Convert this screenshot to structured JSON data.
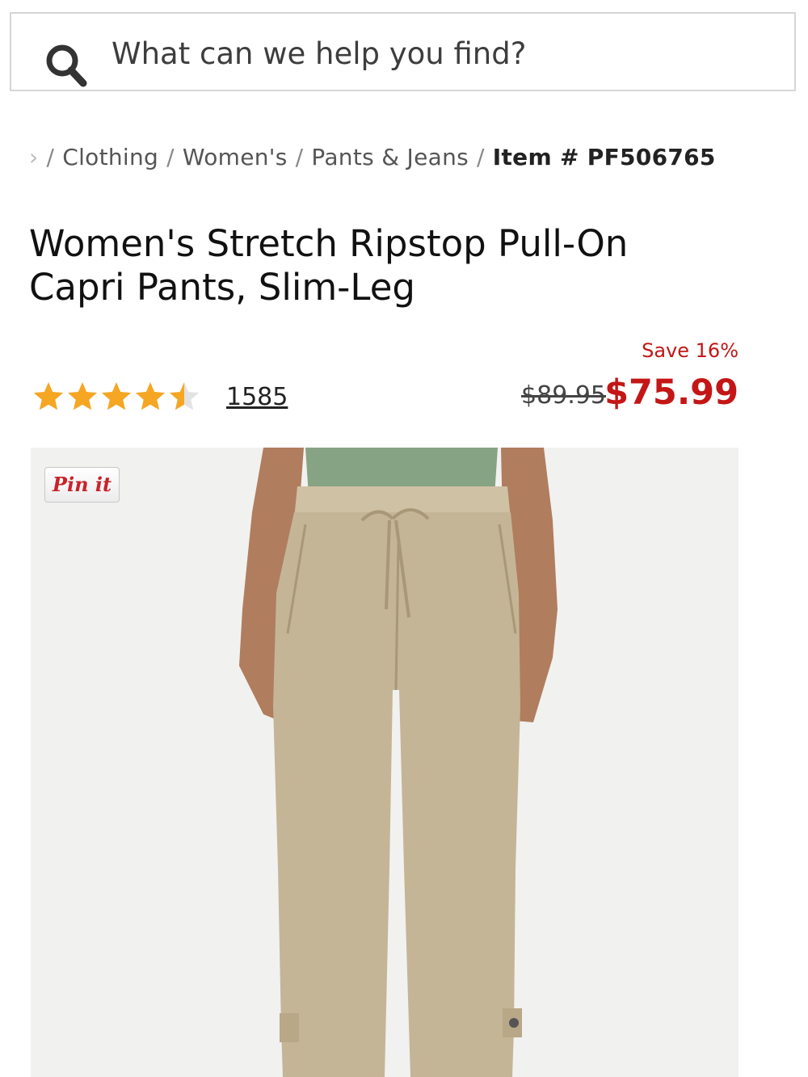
{
  "search": {
    "placeholder": "What can we help you find?",
    "icon": "search-icon"
  },
  "breadcrumb": {
    "items": [
      "Clothing",
      "Women's",
      "Pants & Jeans"
    ],
    "current": "Item # PF506765"
  },
  "product": {
    "title_line1": "Women's Stretch Ripstop Pull-On",
    "title_line2": "Capri Pants, Slim-Leg",
    "rating": {
      "stars": 4.5,
      "max_stars": 5,
      "count": "1585"
    },
    "price": {
      "save_text": "Save 16%",
      "original": "$89.95",
      "sale": "$75.99"
    }
  },
  "pin_button": {
    "label": "Pin it"
  },
  "colors": {
    "accent_red": "#c41616",
    "star_gold": "#f5a623",
    "star_empty": "#e3e3e3",
    "pants_khaki": "#c4b597",
    "top_green": "#86a384",
    "image_bg": "#f1f1f0"
  }
}
